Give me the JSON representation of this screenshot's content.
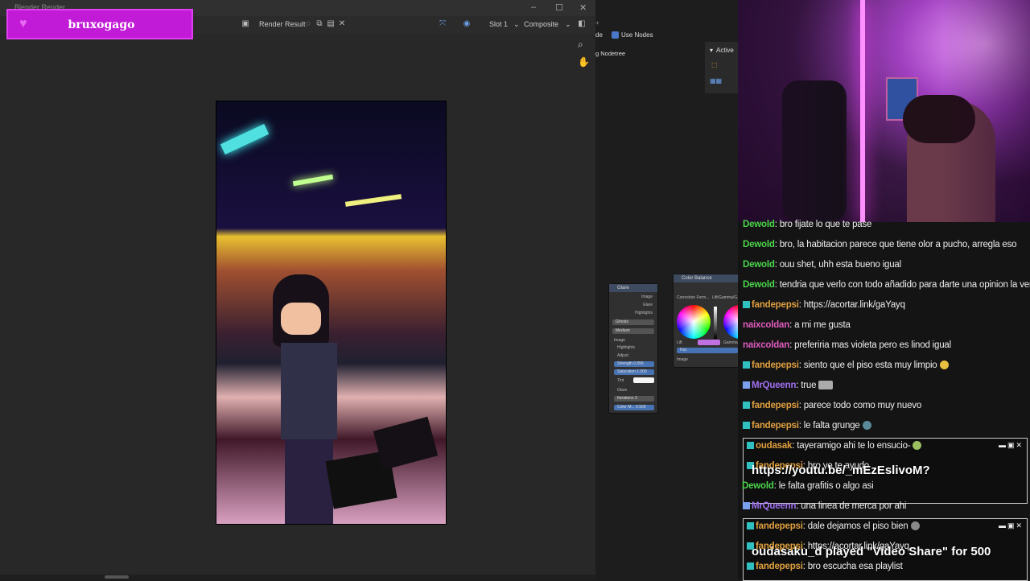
{
  "render_window": {
    "title": "Blender Render",
    "toolbar": {
      "image_name": "Render Result",
      "slot": "Slot 1",
      "pass": "Composite"
    }
  },
  "badge": {
    "name": "bruxogago"
  },
  "node_editor": {
    "use_nodes": "Use Nodes",
    "nodetree": "g Nodetree",
    "active_panel": "Active",
    "glare_node": {
      "title": "Glare",
      "outputs": [
        "Image",
        "Glare",
        "Highlights"
      ],
      "type": "Ghosts",
      "quality": "Medium",
      "input_image": "Image",
      "highlights": "Highlights",
      "adjust": "Adjust",
      "strength": "Strength  0.056",
      "saturation": "Saturation  1.000",
      "tint": "Tint",
      "glare_section": "Glare",
      "iterations": "Iterations   3",
      "color_mod": "Color M...   0.500"
    },
    "color_balance_node": {
      "title": "Color Balance",
      "correction": "Correction Form...",
      "lift_gamma": "Lift/Gamma/G...",
      "lift": "Lift",
      "gamma": "Gamma",
      "fac": "Fac",
      "image": "Image"
    }
  },
  "chat": {
    "messages": [
      {
        "user": "Dewold",
        "color": "#4bd64b",
        "text": ": bro fijate lo que te pase"
      },
      {
        "user": "Dewold",
        "color": "#4bd64b",
        "text": ": bro, la habitacion parece que tiene olor a pucho, arregla eso"
      },
      {
        "user": "Dewold",
        "color": "#4bd64b",
        "text": ": ouu shet, uhh esta bueno igual"
      },
      {
        "user": "Dewold",
        "color": "#4bd64b",
        "text": ": tendria que verlo con todo añadido para darte una opinion la verdad"
      },
      {
        "user": "fandepepsi",
        "color": "#e0a040",
        "text": ": https://acortar.link/gaYayq",
        "badge": true
      },
      {
        "user": "naixcoldan",
        "color": "#e05cc0",
        "text": ": a mi me gusta"
      },
      {
        "user": "naixcoldan",
        "color": "#e05cc0",
        "text": ": preferiria mas violeta pero es linod igual"
      },
      {
        "user": "fandepepsi",
        "color": "#e0a040",
        "text": ": siento que el piso esta muy limpio",
        "badge": true
      },
      {
        "user": "MrQueenn",
        "color": "#a070f0",
        "text": ": true",
        "badge": true
      },
      {
        "user": "fandepepsi",
        "color": "#e0a040",
        "text": ": parece todo como muy nuevo",
        "badge": true
      },
      {
        "user": "fandepepsi",
        "color": "#e0a040",
        "text": ": le falta grunge",
        "badge": true
      },
      {
        "user": "oudasak",
        "color": "#e0a040",
        "text": ": tayeramigo ahi te lo ensucio-",
        "badge": true
      },
      {
        "user": "fandepepsi",
        "color": "#e0a040",
        "text": ": bro yo te ayudo",
        "badge": true
      },
      {
        "user": "Dewold",
        "color": "#4bd64b",
        "text": ": le falta grafitis o algo asi"
      },
      {
        "user": "MrQueenn",
        "color": "#a070f0",
        "text": ": una linea de merca por ahi",
        "badge": true
      },
      {
        "user": "fandepepsi",
        "color": "#e0a040",
        "text": ": dale dejamos el piso bien",
        "badge": true
      },
      {
        "user": "fandepepsi",
        "color": "#e0a040",
        "text": ": https://acortar.link/gaYayq",
        "badge": true
      },
      {
        "user": "fandepepsi",
        "color": "#e0a040",
        "text": ": bro escucha esa playlist",
        "badge": true
      }
    ],
    "popup1_text": "https://youtu.be/_mEzEslivoM?",
    "popup2_text": "oudasaku_d played \"Video Share\" for 500"
  }
}
